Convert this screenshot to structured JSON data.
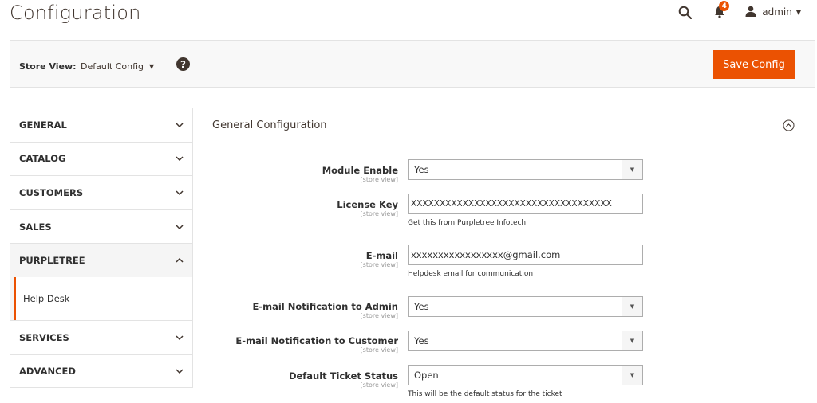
{
  "page": {
    "title": "Configuration"
  },
  "header": {
    "notifications_count": "4",
    "user": "admin"
  },
  "store_bar": {
    "label": "Store View:",
    "scope": "Default Config",
    "help_symbol": "?",
    "save_label": "Save Config"
  },
  "sidebar": {
    "items": [
      {
        "label": "GENERAL",
        "state": "collapsed"
      },
      {
        "label": "CATALOG",
        "state": "collapsed"
      },
      {
        "label": "CUSTOMERS",
        "state": "collapsed"
      },
      {
        "label": "SALES",
        "state": "collapsed"
      },
      {
        "label": "PURPLETREE",
        "state": "expanded"
      },
      {
        "label": "SERVICES",
        "state": "collapsed"
      },
      {
        "label": "ADVANCED",
        "state": "collapsed"
      }
    ],
    "sub_item": "Help Desk"
  },
  "section": {
    "title": "General Configuration"
  },
  "fields": [
    {
      "label": "Module Enable",
      "scope": "[store view]",
      "value": "Yes",
      "type": "select"
    },
    {
      "label": "License Key",
      "scope": "[store view]",
      "value": "XXXXXXXXXXXXXXXXXXXXXXXXXXXXXXXXXXX",
      "type": "text",
      "note": "Get this from Purpletree Infotech"
    },
    {
      "label": "E-mail",
      "scope": "[store view]",
      "value": "xxxxxxxxxxxxxxxxx@gmail.com",
      "type": "text",
      "note": "Helpdesk email for communication"
    },
    {
      "label": "E-mail Notification to Admin",
      "scope": "[store view]",
      "value": "Yes",
      "type": "select"
    },
    {
      "label": "E-mail Notification to Customer",
      "scope": "[store view]",
      "value": "Yes",
      "type": "select"
    },
    {
      "label": "Default Ticket Status",
      "scope": "[store view]",
      "value": "Open",
      "type": "select",
      "note": "This will be the default status for the ticket"
    }
  ],
  "colors": {
    "accent": "#eb5202",
    "text_dark": "#41362f",
    "border": "#e3e3e3"
  }
}
